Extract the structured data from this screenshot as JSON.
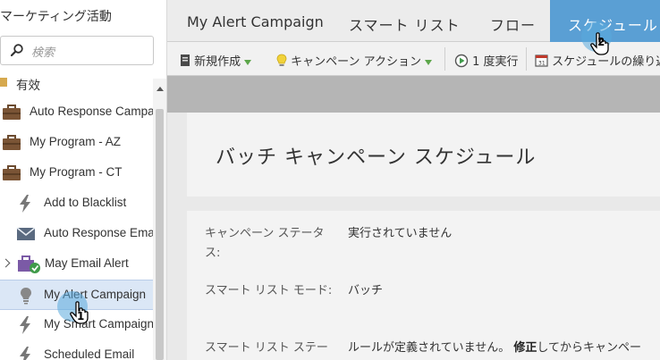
{
  "sidebar": {
    "title": "マーケティング活動",
    "search_placeholder": "検索",
    "partial_row_label": "有效",
    "items": [
      {
        "label": "Auto Response Campaig",
        "icon": "program-briefcase-icon"
      },
      {
        "label": "My Program - AZ",
        "icon": "program-briefcase-icon"
      },
      {
        "label": "My Program - CT",
        "icon": "program-briefcase-icon"
      },
      {
        "label": "Add to Blacklist",
        "icon": "trigger-lightning-icon"
      },
      {
        "label": "Auto Response Email",
        "icon": "email-envelope-icon"
      },
      {
        "label": "May Email Alert",
        "icon": "email-program-check-icon"
      },
      {
        "label": "My Alert Campaign",
        "icon": "batch-bulb-icon"
      },
      {
        "label": "My Smart Campaign",
        "icon": "trigger-lightning-icon"
      },
      {
        "label": "Scheduled Email",
        "icon": "trigger-lightning-icon"
      }
    ]
  },
  "tabs": [
    {
      "label": "My Alert Campaign"
    },
    {
      "label": "スマート リスト"
    },
    {
      "label": "フロー"
    },
    {
      "label": "スケジュール"
    }
  ],
  "toolbar": {
    "new_label": "新規作成",
    "campaign_actions_label": "キャンペーン アクション",
    "run_once_label": "1 度実行",
    "schedule_recurrence_label": "スケジュールの繰り返"
  },
  "content": {
    "heading": "バッチ キャンペーン スケジュール",
    "rows": [
      {
        "label": "キャンペーン ステータス:",
        "value": "実行されていません"
      },
      {
        "label": "スマート リスト モード:",
        "value": "バッチ"
      },
      {
        "label": "スマート リスト ステー",
        "value_pre": "ルールが定義されていません。",
        "value_bold": "修正",
        "value_post": "してからキャンペー"
      }
    ]
  },
  "markers": [
    {
      "number": "1"
    },
    {
      "number": "2"
    }
  ],
  "colors": {
    "accent": "#5a9fd4",
    "selected_row": "#dbe7f6",
    "toolbar_arrow": "#5ca64a"
  }
}
